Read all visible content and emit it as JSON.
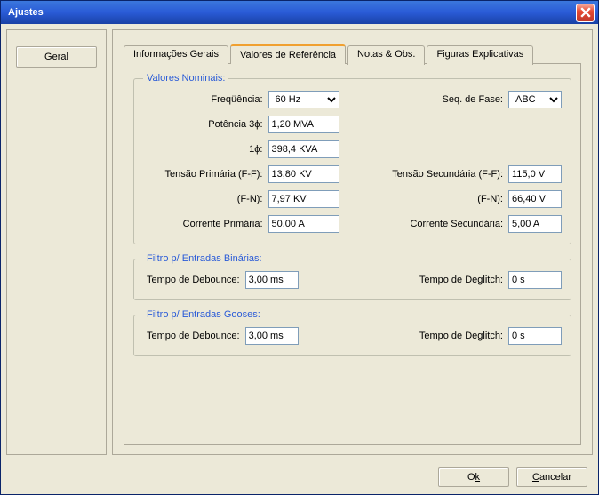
{
  "window": {
    "title": "Ajustes"
  },
  "sidebar": {
    "geral": "Geral"
  },
  "tabs": {
    "t0": "Informações Gerais",
    "t1": "Valores de Referência",
    "t2": "Notas & Obs.",
    "t3": "Figuras Explicativas"
  },
  "groups": {
    "nominais": "Valores Nominais:",
    "binarias": "Filtro p/ Entradas Binárias:",
    "gooses": "Filtro p/ Entradas Gooses:"
  },
  "labels": {
    "frequencia": "Freqüência:",
    "seqfase": "Seq. de Fase:",
    "potencia3f": "Potência 3ϕ:",
    "oneF": "1ϕ:",
    "tensao_prim_ff": "Tensão Primária (F-F):",
    "tensao_sec_ff": "Tensão Secundária (F-F):",
    "fn": "(F-N):",
    "corrente_prim": "Corrente Primária:",
    "corrente_sec": "Corrente Secundária:",
    "tempo_debounce": "Tempo de Debounce:",
    "tempo_deglitch": "Tempo de Deglitch:"
  },
  "values": {
    "frequencia": "60 Hz",
    "seqfase": "ABC",
    "potencia3f": "1,20 MVA",
    "oneF": "398,4 KVA",
    "tensao_prim_ff": "13,80 KV",
    "tensao_sec_ff": "115,0 V",
    "fn_prim": "7,97 KV",
    "fn_sec": "66,40 V",
    "corrente_prim": "50,00 A",
    "corrente_sec": "5,00 A",
    "bin_debounce": "3,00 ms",
    "bin_deglitch": "0 s",
    "goose_debounce": "3,00 ms",
    "goose_deglitch": "0 s"
  },
  "buttons": {
    "ok_pre": "O",
    "ok_u": "k",
    "cancel_pre": "",
    "cancel_u": "C",
    "cancel_post": "ancelar"
  }
}
